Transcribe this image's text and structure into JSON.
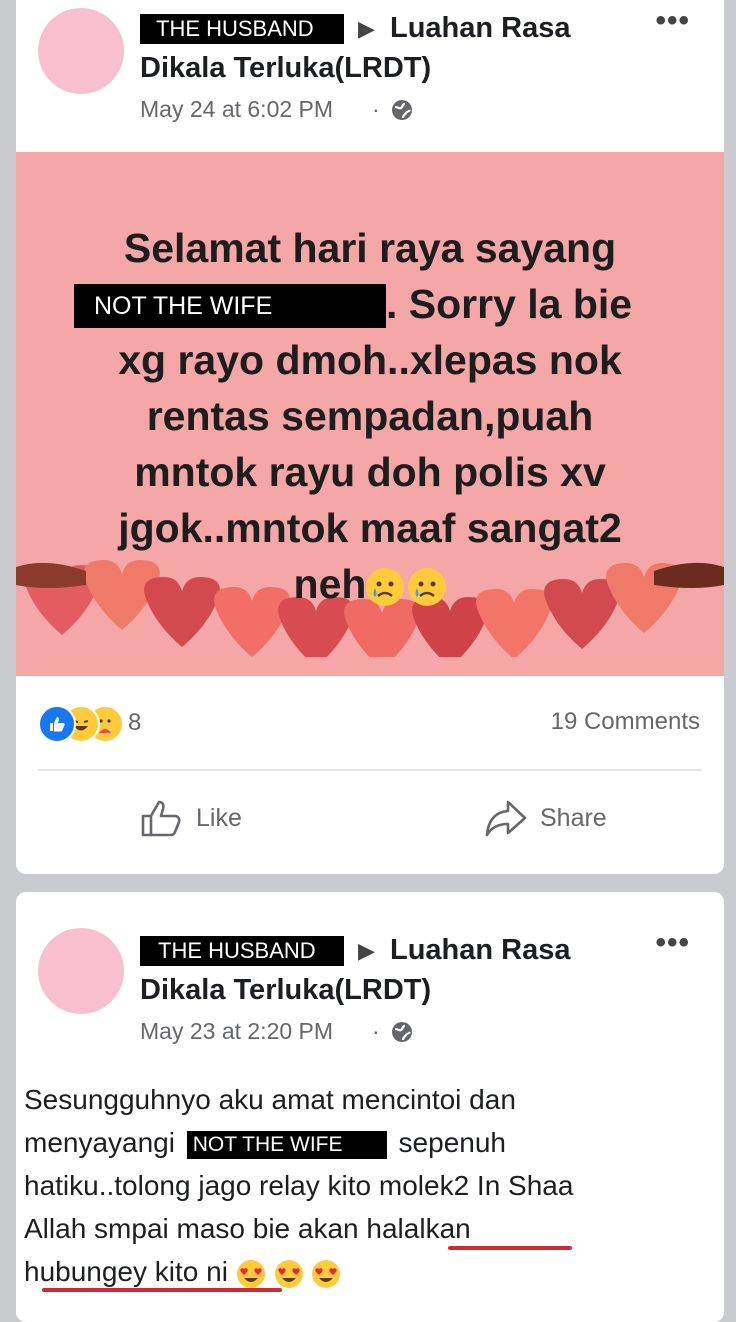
{
  "post1": {
    "redacted_author": "THE HUSBAND",
    "group": "Luahan Rasa Dikala Terluka(LRDT)",
    "group_line1": "Luahan Rasa",
    "group_line2": "Dikala Terluka(LRDT)",
    "timestamp": "May 24 at 6:02 PM",
    "banner_lines": [
      "Selamat hari raya sayang",
      ". Sorry la bie",
      "xg rayo dmoh..xlepas nok",
      "rentas sempadan,puah",
      "mntok rayu doh polis xv",
      "jgok..mntok maaf sangat2",
      "neh"
    ],
    "redacted_wife": "NOT THE WIFE",
    "reaction_count": "8",
    "comments": "19 Comments",
    "like_label": "Like",
    "share_label": "Share",
    "banner_color": "#f5a7a7"
  },
  "post2": {
    "redacted_author": "THE HUSBAND",
    "group_line1": "Luahan Rasa",
    "group_line2": "Dikala Terluka(LRDT)",
    "timestamp": "May 23 at 2:20 PM",
    "text_line1": "Sesungguhnyo aku amat mencintoi dan",
    "text_line2a": "menyayangi",
    "redacted_wife": "NOT THE WIFE",
    "text_line2b": "sepenuh",
    "text_line3": "hatiku..tolong jago relay kito molek2 In Shaa",
    "text_line4a": "Allah smpai maso bie akan ",
    "text_line4b": "halalkan",
    "text_line5": "hubungey kito ni"
  },
  "icons": [
    "globe-icon",
    "more-icon",
    "like-icon",
    "share-icon",
    "crying-emoji-icon",
    "heart-eyes-emoji-icon"
  ]
}
